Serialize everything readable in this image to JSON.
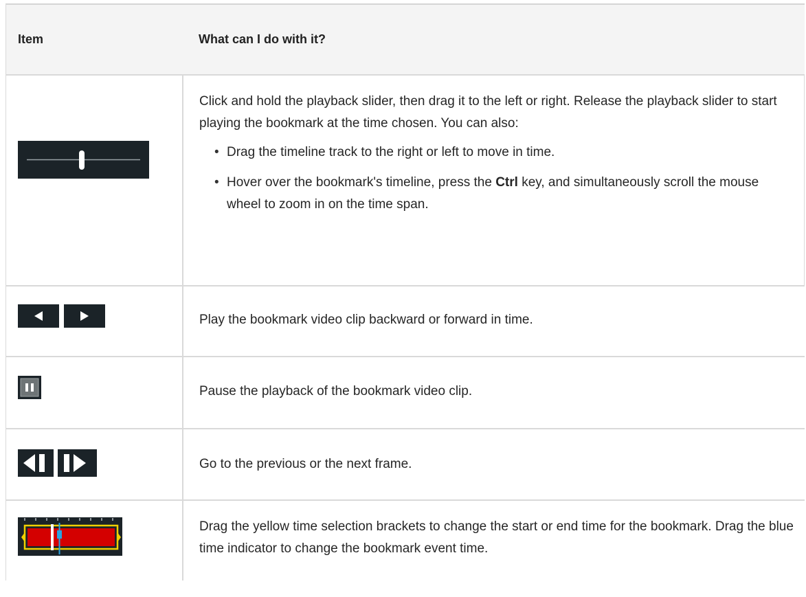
{
  "table": {
    "headers": {
      "item": "Item",
      "what": "What can I do with it?"
    },
    "rows": [
      {
        "icon": "playback-slider-icon",
        "intro": "Click and hold the playback slider, then drag it to the left or right. Release the playback slider to start playing the bookmark at the time chosen. You can also:",
        "bullets": [
          "Drag the timeline track to the right or left to move in time.",
          {
            "pre": "Hover over the bookmark's timeline, press the ",
            "bold": "Ctrl",
            "post": " key, and simultaneously scroll the mouse wheel to zoom in on the time span."
          }
        ]
      },
      {
        "icon": "play-backward-forward-icon",
        "text": "Play the bookmark video clip backward or forward in time."
      },
      {
        "icon": "pause-icon",
        "text": "Pause the playback of the bookmark video clip."
      },
      {
        "icon": "step-frame-icon",
        "text": "Go to the previous or the next frame."
      },
      {
        "icon": "time-selection-brackets-icon",
        "text": "Drag the yellow time selection brackets to change the start or end time for the bookmark. Drag the blue time indicator to change the bookmark event time."
      }
    ]
  },
  "colors": {
    "header_bg": "#f4f4f4",
    "border": "#d9d9d9",
    "icon_bg": "#1b2328",
    "bracket": "#f0d000",
    "marker": "#2aa3e0",
    "selection": "#d40000"
  }
}
